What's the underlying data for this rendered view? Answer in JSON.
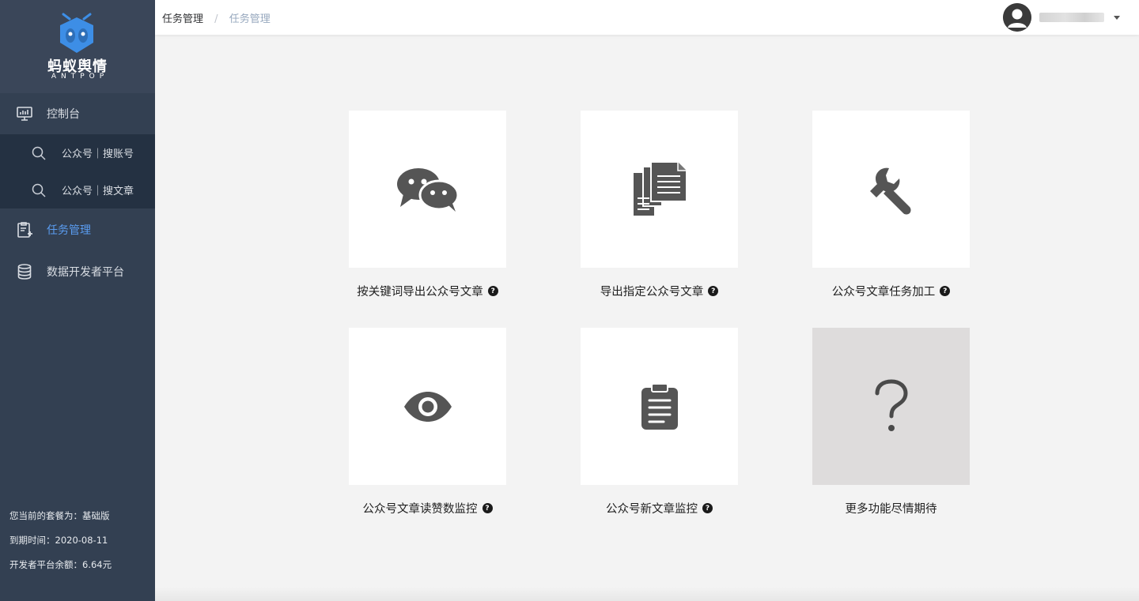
{
  "sidebar": {
    "logo": {
      "name": "蚂蚁舆情",
      "sub": "ANTPOP",
      "color": "#3d8ee6"
    },
    "menu": [
      {
        "label": "控制台",
        "icon": "monitor-chart-icon"
      },
      {
        "label": "任务管理",
        "icon": "task-clipboard-icon",
        "active": true
      },
      {
        "label": "数据开发者平台",
        "icon": "database-icon"
      }
    ],
    "submenu": [
      {
        "label": "公众号｜搜账号",
        "icon": "search-icon"
      },
      {
        "label": "公众号｜搜文章",
        "icon": "search-icon"
      }
    ],
    "plan": {
      "package": "您当前的套餐为：基础版",
      "expire": "到期时间：2020-08-11",
      "balance": "开发者平台余额：6.64元"
    }
  },
  "header": {
    "breadcrumb": [
      "任务管理",
      "任务管理"
    ],
    "separator": "/",
    "user": {
      "avatar": "user-avatar-icon",
      "name": "5"
    }
  },
  "cards": [
    {
      "label": "按关键词导出公众号文章",
      "icon": "wechat-icon",
      "help": "?"
    },
    {
      "label": "导出指定公众号文章",
      "icon": "documents-icon",
      "help": "?"
    },
    {
      "label": "公众号文章任务加工",
      "icon": "wrench-icon",
      "help": "?"
    },
    {
      "label": "公众号文章读赞数监控",
      "icon": "eye-icon",
      "help": "?"
    },
    {
      "label": "公众号新文章监控",
      "icon": "clipboard-icon",
      "help": "?"
    },
    {
      "label": "更多功能尽情期待",
      "icon": "question-mark-icon"
    }
  ],
  "colors": {
    "sidebar_bg": "#334052",
    "submenu_bg": "#243142",
    "active": "#5a9cf0",
    "icon": "#555555",
    "page_bg": "#f3f3f3"
  }
}
